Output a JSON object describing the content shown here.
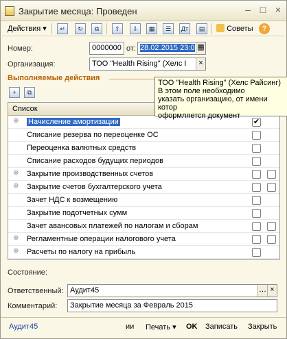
{
  "window": {
    "title": "Закрытие месяца: Проведен",
    "controls": [
      "–",
      "□",
      "×"
    ]
  },
  "toolbar": {
    "actions_label": "Действия",
    "tips_label": "Советы",
    "help_label": "?"
  },
  "header": {
    "number_label": "Номер:",
    "number_value": "0000000",
    "date_label": "от:",
    "date_value": "28.02.2015 23:0",
    "org_label": "Организация:",
    "org_value": "ТОО \"Health Rising\" (Хелс I"
  },
  "section": {
    "title": "Выполняемые действия",
    "list_header": "Список"
  },
  "actions": [
    {
      "label": "Начисление амортизации",
      "expand": true,
      "checked1": true,
      "cb2": false
    },
    {
      "label": "Списание резерва по переоценке ОС",
      "expand": false,
      "checked1": false,
      "cb2": false
    },
    {
      "label": "Переоценка валютных средств",
      "expand": false,
      "checked1": false,
      "cb2": false
    },
    {
      "label": "Списание расходов будущих периодов",
      "expand": false,
      "checked1": false,
      "cb2": false
    },
    {
      "label": "Закрытие производственных счетов",
      "expand": true,
      "checked1": false,
      "cb2": true
    },
    {
      "label": "Закрытие счетов бухгалтерского учета",
      "expand": true,
      "checked1": false,
      "cb2": true
    },
    {
      "label": "Зачет НДС к возмещению",
      "expand": false,
      "checked1": false,
      "cb2": false
    },
    {
      "label": "Закрытие подотчетных сумм",
      "expand": false,
      "checked1": false,
      "cb2": false
    },
    {
      "label": "Зачет авансовых платежей по налогам и сборам",
      "expand": false,
      "checked1": false,
      "cb2": true
    },
    {
      "label": "Регламентные операции налогового учета",
      "expand": true,
      "checked1": false,
      "cb2": true
    },
    {
      "label": "Расчеты по налогу на прибыль",
      "expand": true,
      "checked1": false,
      "cb2": false
    }
  ],
  "tooltip": {
    "line1": "ТОО \"Health Rising\" (Хелс Райсинг)",
    "line2": "В этом поле необходимо",
    "line3": "указать организацию, от имени котор",
    "line4": "оформляется документ"
  },
  "footer_fields": {
    "state_label": "Состояние:",
    "responsible_label": "Ответственный:",
    "responsible_value": "Аудит45",
    "comment_label": "Комментарий:",
    "comment_value": "Закрытие месяца за Февраль 2015"
  },
  "bottombar": {
    "user_link": "Аудит45",
    "misc": "ии",
    "print_label": "Печать",
    "ok_label": "OK",
    "save_label": "Записать",
    "close_label": "Закрыть"
  }
}
